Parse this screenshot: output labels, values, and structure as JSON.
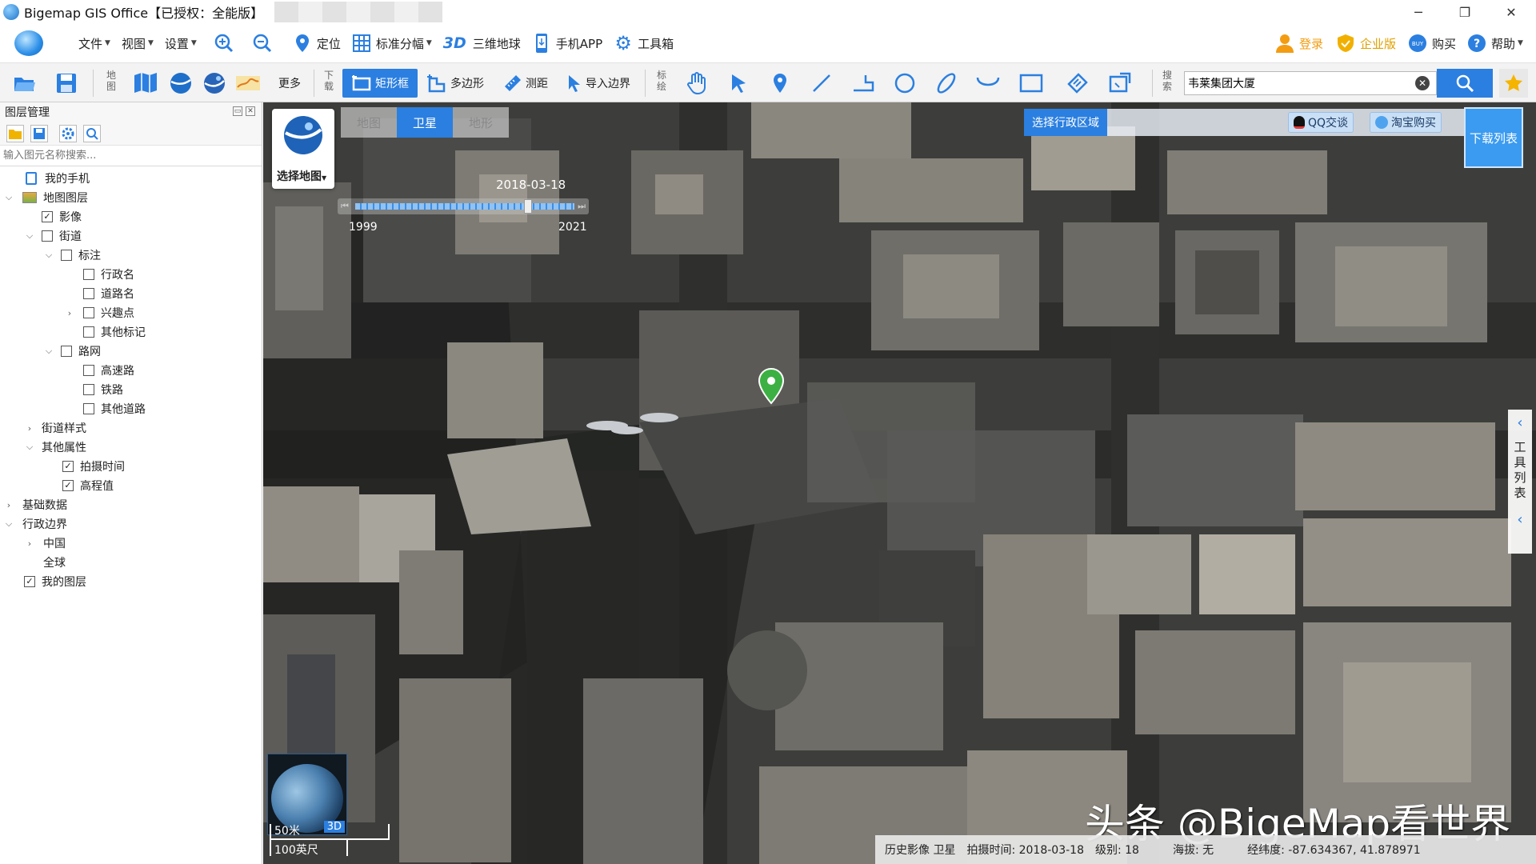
{
  "window": {
    "title": "Bigemap GIS Office【已授权：全能版】"
  },
  "menu": {
    "file": "文件",
    "view": "视图",
    "settings": "设置",
    "locate": "定位",
    "standard_sheet": "标准分幅",
    "globe3d_prefix": "3D",
    "globe3d": "三维地球",
    "mobile_app": "手机APP",
    "toolbox": "工具箱",
    "login": "登录",
    "enterprise": "企业版",
    "buy": "购买",
    "help": "帮助"
  },
  "toolbar": {
    "map_vlabel": "地图",
    "more": "更多",
    "download_vlabel": "下载",
    "rect_frame": "矩形框",
    "polygon": "多边形",
    "measure": "测距",
    "import_boundary": "导入边界",
    "mark_vlabel": "标绘",
    "search_vlabel": "搜索",
    "search_value": "韦莱集团大厦"
  },
  "panel": {
    "title": "图层管理",
    "search_placeholder": "输入图元名称搜索..."
  },
  "tree": [
    {
      "label": "我的手机",
      "checked": null
    },
    {
      "label": "地图图层",
      "checked": null
    },
    {
      "label": "影像",
      "checked": true
    },
    {
      "label": "街道",
      "checked": false
    },
    {
      "label": "标注",
      "checked": false
    },
    {
      "label": "行政名",
      "checked": false
    },
    {
      "label": "道路名",
      "checked": false
    },
    {
      "label": "兴趣点",
      "checked": false
    },
    {
      "label": "其他标记",
      "checked": false
    },
    {
      "label": "路网",
      "checked": false
    },
    {
      "label": "高速路",
      "checked": false
    },
    {
      "label": "铁路",
      "checked": false
    },
    {
      "label": "其他道路",
      "checked": false
    },
    {
      "label": "街道样式",
      "checked": null
    },
    {
      "label": "其他属性",
      "checked": null
    },
    {
      "label": "拍摄时间",
      "checked": true
    },
    {
      "label": "高程值",
      "checked": true
    },
    {
      "label": "基础数据",
      "checked": null
    },
    {
      "label": "行政边界",
      "checked": null
    },
    {
      "label": "中国",
      "checked": null
    },
    {
      "label": "全球",
      "checked": null
    },
    {
      "label": "我的图层",
      "checked": true
    }
  ],
  "map": {
    "tabs": [
      "地图",
      "卫星",
      "地形"
    ],
    "active_tab": "卫星",
    "select_map": "选择地图",
    "timeline": {
      "current": "2018-03-18",
      "start": "1999",
      "end": "2021",
      "position": 0.78
    },
    "select_admin": "选择行政区域",
    "qq_chat": "QQ交谈",
    "taobao_buy": "淘宝购买",
    "download_list": "下载列表",
    "side_panel": "工具列表",
    "globe_badge": "3D",
    "scale_metric": "50米",
    "scale_imperial": "100英尺",
    "watermark": "头条 @BigeMap看世界"
  },
  "status": {
    "layer": "历史影像 卫星",
    "capture_time": "拍摄时间: 2018-03-18",
    "level": "级别: 18",
    "altitude": "海拔: 无",
    "coords": "经纬度: -87.634367, 41.878971"
  },
  "colors": {
    "accent": "#2b7fe0",
    "pin": "#3cb043"
  }
}
